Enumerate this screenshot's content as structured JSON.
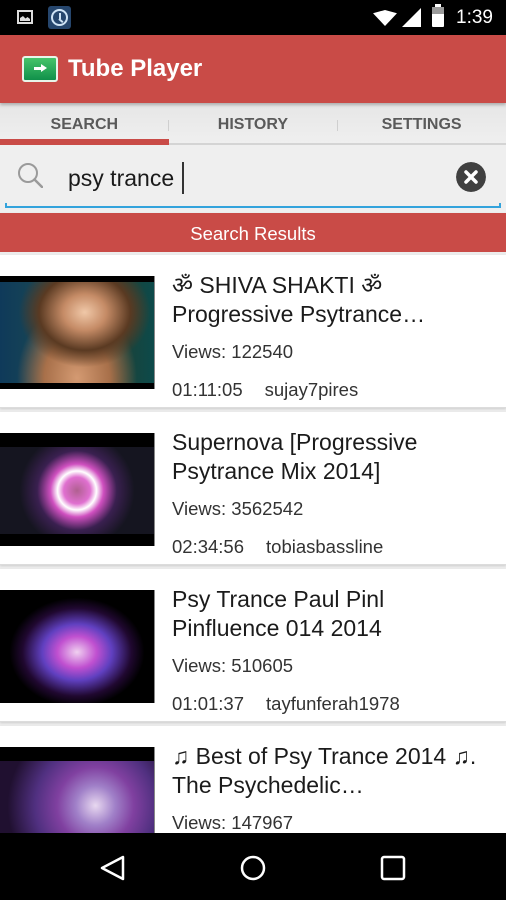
{
  "status_bar": {
    "time": "1:39",
    "icons": [
      "image-notification-icon",
      "clock-app-icon",
      "wifi-icon",
      "cell-signal-icon",
      "battery-icon"
    ]
  },
  "app_bar": {
    "title": "Tube Player",
    "logo_icon": "tube-player-logo-icon"
  },
  "tabs": [
    {
      "label": "SEARCH",
      "active": true
    },
    {
      "label": "HISTORY",
      "active": false
    },
    {
      "label": "SETTINGS",
      "active": false
    }
  ],
  "search": {
    "value": "psy trance",
    "icon": "search-icon",
    "clear_icon": "clear-icon"
  },
  "results_banner": "Search Results",
  "results": [
    {
      "title": "ॐ SHIVA SHAKTI ॐ Progressive Psytrance…",
      "views": "Views: 122540",
      "duration": "01:11:05",
      "channel": "sujay7pires",
      "thumbnail": "woman-lighting-pipe-thumbnail"
    },
    {
      "title": "Supernova [Progressive Psytrance Mix 2014]",
      "views": "Views: 3562542",
      "duration": "02:34:56",
      "channel": "tobiasbassline",
      "thumbnail": "psychedelic-star-mandala-thumbnail"
    },
    {
      "title": "Psy Trance Paul Pinl Pinfluence 014 2014",
      "views": "Views: 510605",
      "duration": "01:01:37",
      "channel": "tayfunferah1978",
      "thumbnail": "joker-headphones-thumbnail"
    },
    {
      "title": "♫ Best of Psy Trance 2014 ♫. The Psychedelic…",
      "views": "Views: 147967",
      "duration": "",
      "channel": "",
      "thumbnail": "purple-fractal-thumbnail"
    }
  ],
  "colors": {
    "accent": "#C94B47",
    "search_underline": "#33A3DC",
    "tab_text": "#5A5A5A"
  },
  "nav_bar": {
    "buttons": [
      "back",
      "home",
      "recents"
    ]
  }
}
